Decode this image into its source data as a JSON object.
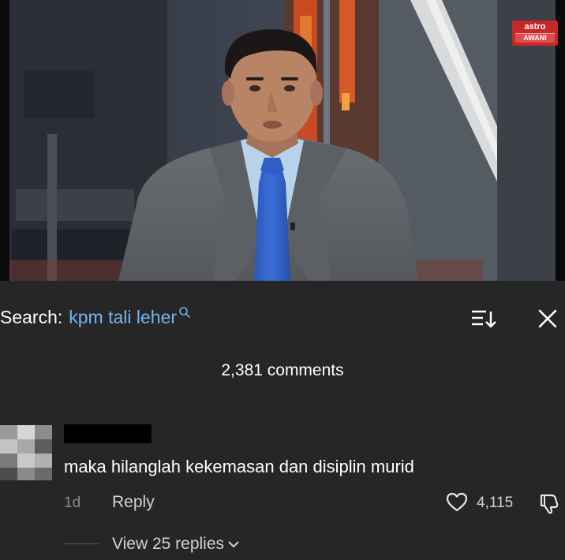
{
  "video": {
    "channel_logo": {
      "line1": "astro",
      "line2": "AWANI"
    }
  },
  "search": {
    "label": "Search:",
    "query": "kpm tali leher"
  },
  "comments": {
    "count_label": "2,381 comments"
  },
  "comment": {
    "text": "maka hilanglah kekemasan dan disiplin murid",
    "time": "1d",
    "reply_label": "Reply",
    "like_count": "4,115",
    "view_replies_label": "View 25 replies"
  },
  "colors": {
    "background": "#262626",
    "search_query": "#74b4f0",
    "muted_text": "#8a8a8a",
    "secondary_text": "#d2d2d2",
    "logo_red": "#c62828"
  },
  "icons": [
    "search-icon",
    "sort-icon",
    "close-icon",
    "heart-icon",
    "dislike-icon",
    "chevron-down-icon"
  ]
}
